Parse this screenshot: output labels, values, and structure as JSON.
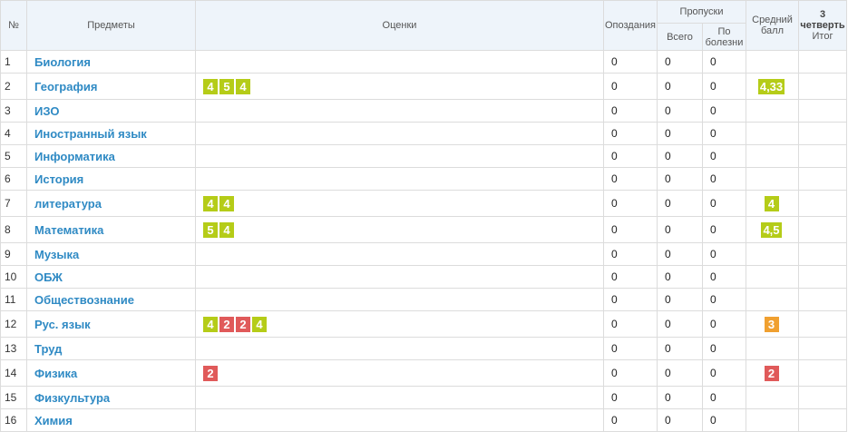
{
  "colors": {
    "good": "#b5cc18",
    "bad": "#e05a5a",
    "mid": "#f0a030",
    "subject_link": "#2f8ac4",
    "header_bg": "#eef4fa"
  },
  "header": {
    "num": "№",
    "subjects": "Предметы",
    "grades": "Оценки",
    "late": "Опоздания",
    "absences": "Пропуски",
    "absences_total": "Всего",
    "absences_sick": "По болезни",
    "average": "Средний балл",
    "quarter_num": "3",
    "quarter_name": "четверть",
    "quarter_total": "Итог"
  },
  "rows": [
    {
      "num": "1",
      "subject": "Биология",
      "marks": [],
      "late": "0",
      "total": "0",
      "sick": "0",
      "avg": null
    },
    {
      "num": "2",
      "subject": "География",
      "marks": [
        {
          "v": "4",
          "c": "g"
        },
        {
          "v": "5",
          "c": "g"
        },
        {
          "v": "4",
          "c": "g"
        }
      ],
      "late": "0",
      "total": "0",
      "sick": "0",
      "avg": {
        "v": "4,33",
        "c": "g"
      }
    },
    {
      "num": "3",
      "subject": "ИЗО",
      "marks": [],
      "late": "0",
      "total": "0",
      "sick": "0",
      "avg": null
    },
    {
      "num": "4",
      "subject": "Иностранный язык",
      "marks": [],
      "late": "0",
      "total": "0",
      "sick": "0",
      "avg": null
    },
    {
      "num": "5",
      "subject": "Информатика",
      "marks": [],
      "late": "0",
      "total": "0",
      "sick": "0",
      "avg": null
    },
    {
      "num": "6",
      "subject": "История",
      "marks": [],
      "late": "0",
      "total": "0",
      "sick": "0",
      "avg": null
    },
    {
      "num": "7",
      "subject": "литература",
      "marks": [
        {
          "v": "4",
          "c": "g"
        },
        {
          "v": "4",
          "c": "g"
        }
      ],
      "late": "0",
      "total": "0",
      "sick": "0",
      "avg": {
        "v": "4",
        "c": "g"
      }
    },
    {
      "num": "8",
      "subject": "Математика",
      "marks": [
        {
          "v": "5",
          "c": "g"
        },
        {
          "v": "4",
          "c": "g"
        }
      ],
      "late": "0",
      "total": "0",
      "sick": "0",
      "avg": {
        "v": "4,5",
        "c": "g"
      }
    },
    {
      "num": "9",
      "subject": "Музыка",
      "marks": [],
      "late": "0",
      "total": "0",
      "sick": "0",
      "avg": null
    },
    {
      "num": "10",
      "subject": "ОБЖ",
      "marks": [],
      "late": "0",
      "total": "0",
      "sick": "0",
      "avg": null
    },
    {
      "num": "11",
      "subject": "Обществознание",
      "marks": [],
      "late": "0",
      "total": "0",
      "sick": "0",
      "avg": null
    },
    {
      "num": "12",
      "subject": "Рус. язык",
      "marks": [
        {
          "v": "4",
          "c": "g"
        },
        {
          "v": "2",
          "c": "r"
        },
        {
          "v": "2",
          "c": "r"
        },
        {
          "v": "4",
          "c": "g"
        }
      ],
      "late": "0",
      "total": "0",
      "sick": "0",
      "avg": {
        "v": "3",
        "c": "o"
      }
    },
    {
      "num": "13",
      "subject": "Труд",
      "marks": [],
      "late": "0",
      "total": "0",
      "sick": "0",
      "avg": null
    },
    {
      "num": "14",
      "subject": "Физика",
      "marks": [
        {
          "v": "2",
          "c": "r"
        }
      ],
      "late": "0",
      "total": "0",
      "sick": "0",
      "avg": {
        "v": "2",
        "c": "r"
      }
    },
    {
      "num": "15",
      "subject": "Физкультура",
      "marks": [],
      "late": "0",
      "total": "0",
      "sick": "0",
      "avg": null
    },
    {
      "num": "16",
      "subject": "Химия",
      "marks": [],
      "late": "0",
      "total": "0",
      "sick": "0",
      "avg": null
    }
  ]
}
